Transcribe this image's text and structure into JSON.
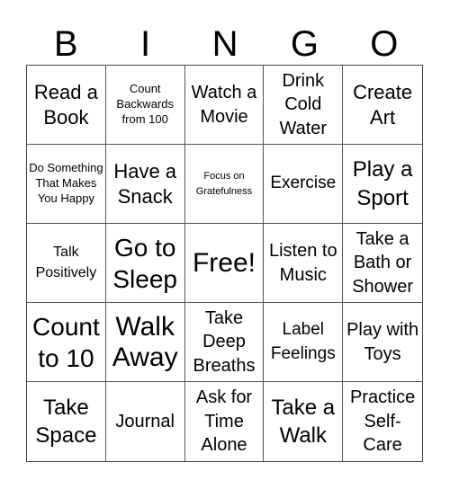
{
  "header": [
    "B",
    "I",
    "N",
    "G",
    "O"
  ],
  "cells": [
    "Read a Book",
    "Count Backwards from 100",
    "Watch a Movie",
    "Drink Cold Water",
    "Create Art",
    "Do Something That Makes You Happy",
    "Have a Snack",
    "Focus on Gratefulness",
    "Exercise",
    "Play a Sport",
    "Talk Positively",
    "Go to Sleep",
    "Free!",
    "Listen to Music",
    "Take a Bath or Shower",
    "Count to 10",
    "Walk Away",
    "Take Deep Breaths",
    "Label Feelings",
    "Play with Toys",
    "Take Space",
    "Journal",
    "Ask for Time Alone",
    "Take a Walk",
    "Practice Self-Care"
  ]
}
